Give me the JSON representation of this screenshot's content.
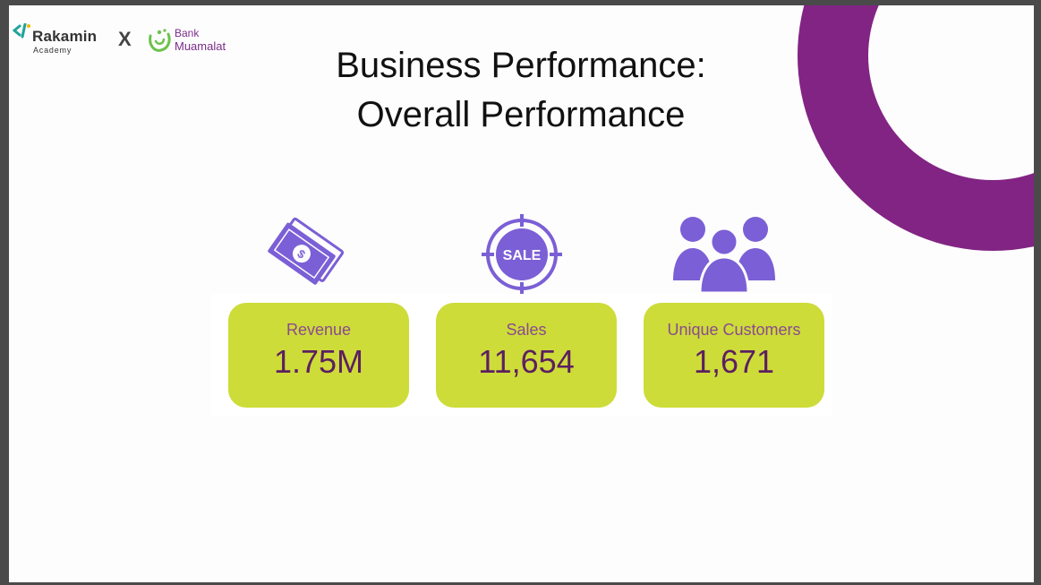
{
  "header": {
    "rakamin_name": "Rakamin",
    "rakamin_sub": "Academy",
    "separator": "X",
    "bank_line1": "Bank",
    "bank_line2": "Muamalat"
  },
  "title": {
    "line1": "Business Performance:",
    "line2": "Overall Performance"
  },
  "kpis": [
    {
      "label": "Revenue",
      "value": "1.75M",
      "icon": "money-icon"
    },
    {
      "label": "Sales",
      "value": "11,654",
      "icon": "sale-target-icon"
    },
    {
      "label": "Unique Customers",
      "value": "1,671",
      "icon": "customers-icon"
    }
  ],
  "icon_texts": {
    "sale_badge": "SALE"
  },
  "colors": {
    "accent_purple": "#822483",
    "icon_purple": "#7b5fd6",
    "card_lime": "#cddc39",
    "value_text": "#5c1f60",
    "label_text": "#8a4a8f"
  }
}
